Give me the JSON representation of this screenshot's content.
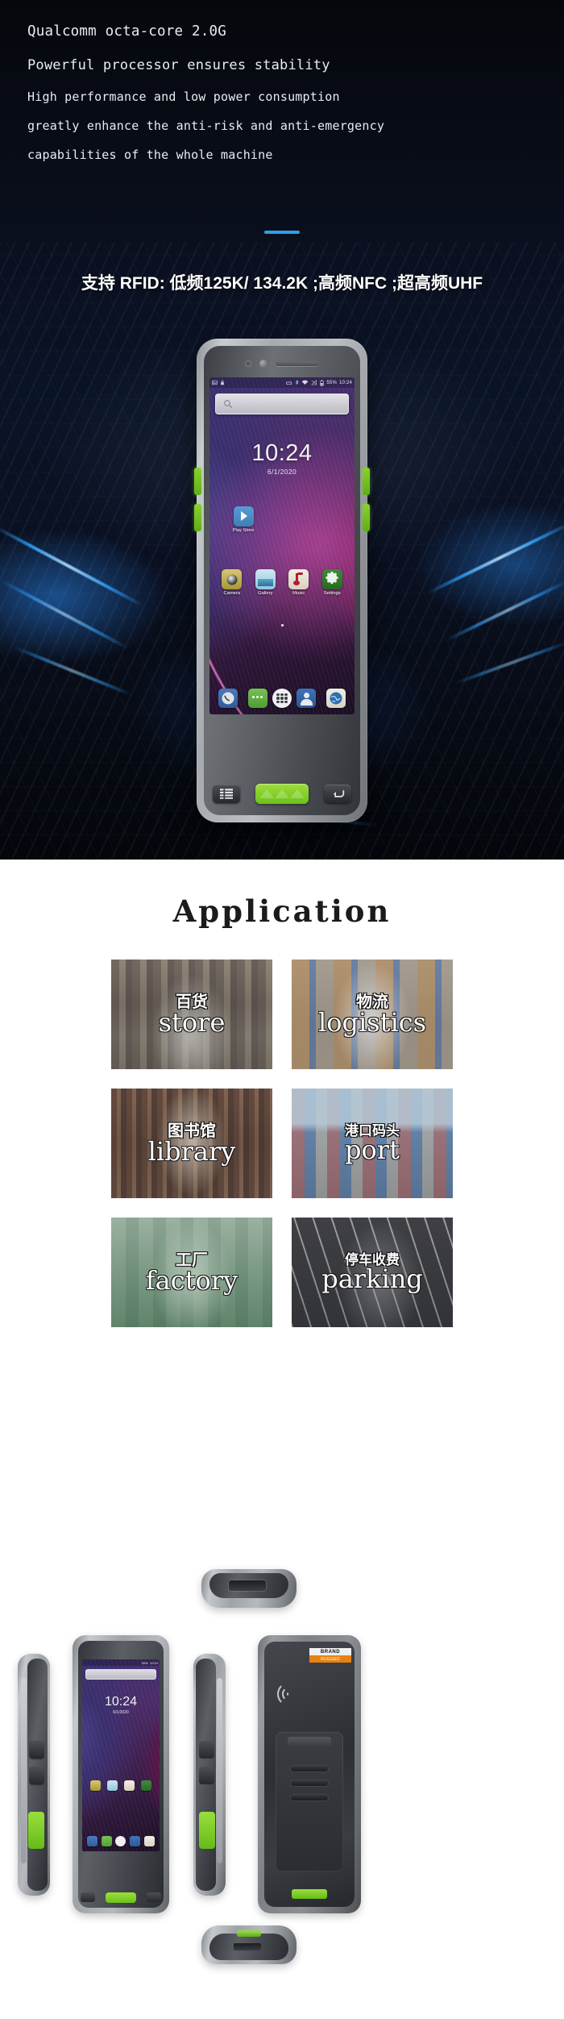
{
  "hero": {
    "spec_lines": [
      "Qualcomm octa-core 2.0G",
      "Powerful processor ensures stability",
      "High performance and low power consumption",
      "greatly enhance the anti-risk and anti-emergency",
      "capabilities of the whole machine"
    ],
    "rfid_text": "支持 RFID: 低频125K/ 134.2K ;高频NFC ;超高频UHF",
    "accent_color": "#2e9fe8"
  },
  "phone": {
    "status_bar": {
      "battery_percent": "55%",
      "time": "10:24",
      "icons": [
        "photo-icon",
        "lock-icon",
        "usb-icon",
        "bluetooth-icon",
        "wifi-icon",
        "signal-off-icon",
        "battery-icon"
      ]
    },
    "search": {
      "placeholder": "",
      "icon": "search-icon"
    },
    "clock_widget": {
      "time": "10:24",
      "date": "6/1/2020"
    },
    "home_apps": [
      {
        "label": "Play Store",
        "icon": "play-store-icon"
      }
    ],
    "app_row": [
      {
        "label": "Camera",
        "icon": "camera-icon"
      },
      {
        "label": "Gallery",
        "icon": "gallery-icon"
      },
      {
        "label": "Music",
        "icon": "music-icon"
      },
      {
        "label": "Settings",
        "icon": "settings-gear-icon"
      }
    ],
    "dock": [
      {
        "label": "Phone",
        "icon": "phone-icon"
      },
      {
        "label": "Messages",
        "icon": "messages-icon"
      },
      {
        "label": "Apps",
        "icon": "app-drawer-icon"
      },
      {
        "label": "Contacts",
        "icon": "contacts-icon"
      },
      {
        "label": "Browser",
        "icon": "browser-globe-icon"
      }
    ],
    "hardware_keys": [
      {
        "label": "Menu",
        "icon": "menu-icon"
      },
      {
        "label": "Scan",
        "icon": "scan-trigger-icon"
      },
      {
        "label": "Back",
        "icon": "back-arrow-icon"
      }
    ]
  },
  "application": {
    "title": "Application",
    "tiles": [
      {
        "cn": "百货",
        "en": "store",
        "photo": "ph-store"
      },
      {
        "cn": "物流",
        "en": "logistics",
        "photo": "ph-logi"
      },
      {
        "cn": "图书馆",
        "en": "library",
        "photo": "ph-lib"
      },
      {
        "cn": "港口码头",
        "en": "port",
        "photo": "ph-port"
      },
      {
        "cn": "工厂",
        "en": "factory",
        "photo": "ph-fact"
      },
      {
        "cn": "停车收费",
        "en": "parking",
        "photo": "ph-park"
      }
    ]
  },
  "product_views": {
    "back_brand": {
      "line1": "BRAND",
      "line2": "RUGGED"
    },
    "front_screen": {
      "time": "10:24",
      "date": "6/1/2020",
      "battery": "55%"
    },
    "views": [
      "top-view",
      "left-side-view",
      "front-view",
      "right-side-view",
      "back-view",
      "bottom-view"
    ]
  }
}
